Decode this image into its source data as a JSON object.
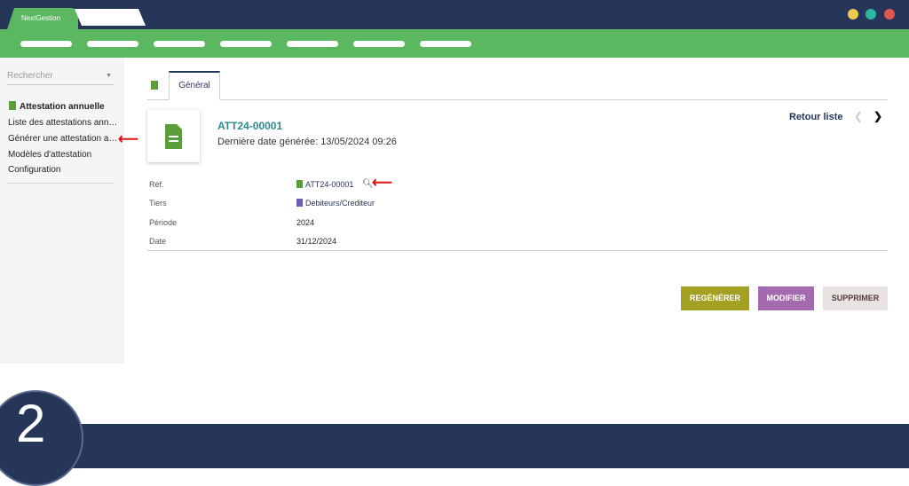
{
  "app": {
    "tab_label": "NextGestion",
    "colors": {
      "titlebar": "#263659",
      "accent_green": "#5cb860",
      "dot_yellow": "#f2c94c",
      "dot_teal": "#2bb8a3",
      "dot_red": "#e0574f"
    }
  },
  "sidebar": {
    "search_placeholder": "Rechercher",
    "section_title": "Attestation annuelle",
    "items": [
      "Liste des attestations annuelles",
      "Générer une attestation annuelle",
      "Modèles d'attestation",
      "Configuration"
    ]
  },
  "main": {
    "tab_general": "Général",
    "ref_title": "ATT24-00001",
    "last_generated": "Dernière date générée: 13/05/2024 09:26",
    "retour_label": "Retour liste",
    "fields": [
      {
        "label": "Réf.",
        "value": "ATT24-00001"
      },
      {
        "label": "Tiers",
        "value": "Debiteurs/Crediteur"
      },
      {
        "label": "Période",
        "value": "2024"
      },
      {
        "label": "Date",
        "value": "31/12/2024"
      }
    ],
    "buttons": {
      "regenerate": "REGÉNÉRER",
      "modify": "MODIFIER",
      "delete": "SUPPRIMER"
    }
  },
  "step_number": "2"
}
